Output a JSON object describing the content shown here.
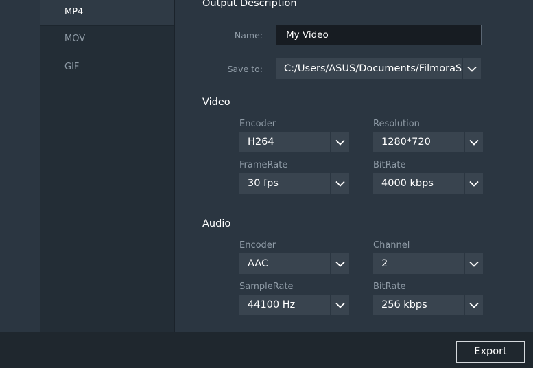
{
  "formats": [
    {
      "label": "MP4",
      "selected": true
    },
    {
      "label": "MOV",
      "selected": false
    },
    {
      "label": "GIF",
      "selected": false
    }
  ],
  "output": {
    "title": "Output Description",
    "name_label": "Name:",
    "name_value": "My Video",
    "save_label": "Save to:",
    "save_value": "C:/Users/ASUS/Documents/FilmoraS"
  },
  "video": {
    "title": "Video",
    "encoder_label": "Encoder",
    "encoder_value": "H264",
    "resolution_label": "Resolution",
    "resolution_value": "1280*720",
    "framerate_label": "FrameRate",
    "framerate_value": "30 fps",
    "bitrate_label": "BitRate",
    "bitrate_value": "4000 kbps"
  },
  "audio": {
    "title": "Audio",
    "encoder_label": "Encoder",
    "encoder_value": "AAC",
    "channel_label": "Channel",
    "channel_value": "2",
    "samplerate_label": "SampleRate",
    "samplerate_value": "44100 Hz",
    "bitrate_label": "BitRate",
    "bitrate_value": "256 kbps"
  },
  "footer": {
    "export_label": "Export"
  },
  "icons": {
    "dropdown": "chevron-down-icon"
  },
  "colors": {
    "panel_bg": "#2b3641",
    "list_bg": "#232d36",
    "select_bg": "#39444f",
    "footer_bg": "#1f272e"
  }
}
